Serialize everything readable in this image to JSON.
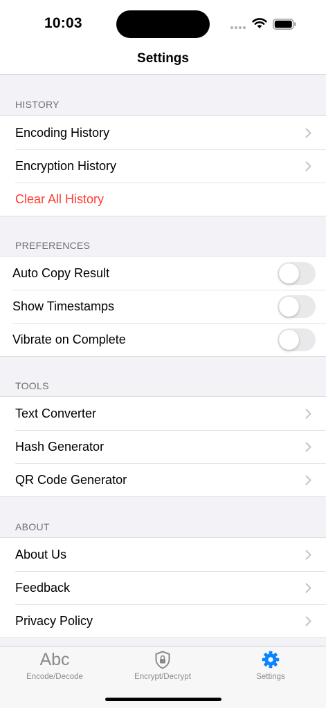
{
  "status_bar": {
    "time": "10:03"
  },
  "nav": {
    "title": "Settings"
  },
  "sections": {
    "history": {
      "header": "HISTORY",
      "items": [
        {
          "label": "Encoding History",
          "chevron": true
        },
        {
          "label": "Encryption History",
          "chevron": true
        },
        {
          "label": "Clear All History",
          "destructive": true,
          "color": "#ff3b30"
        }
      ]
    },
    "preferences": {
      "header": "PREFERENCES",
      "items": [
        {
          "label": "Auto Copy Result",
          "toggle_on": false
        },
        {
          "label": "Show Timestamps",
          "toggle_on": false
        },
        {
          "label": "Vibrate on Complete",
          "toggle_on": false
        }
      ]
    },
    "tools": {
      "header": "TOOLS",
      "items": [
        {
          "label": "Text Converter",
          "chevron": true
        },
        {
          "label": "Hash Generator",
          "chevron": true
        },
        {
          "label": "QR Code Generator",
          "chevron": true
        }
      ]
    },
    "about": {
      "header": "ABOUT",
      "items": [
        {
          "label": "About Us",
          "chevron": true
        },
        {
          "label": "Feedback",
          "chevron": true
        },
        {
          "label": "Privacy Policy",
          "chevron": true
        }
      ]
    }
  },
  "tab_bar": {
    "tabs": [
      {
        "label": "Encode/Decode",
        "icon": "abc-text-icon",
        "icon_text": "Abc",
        "active": false
      },
      {
        "label": "Encrypt/Decrypt",
        "icon": "lock-shield-icon",
        "active": false
      },
      {
        "label": "Settings",
        "icon": "gear-icon",
        "active": true
      }
    ],
    "active_color": "#0a84ff",
    "inactive_color": "#8a8a8e"
  }
}
